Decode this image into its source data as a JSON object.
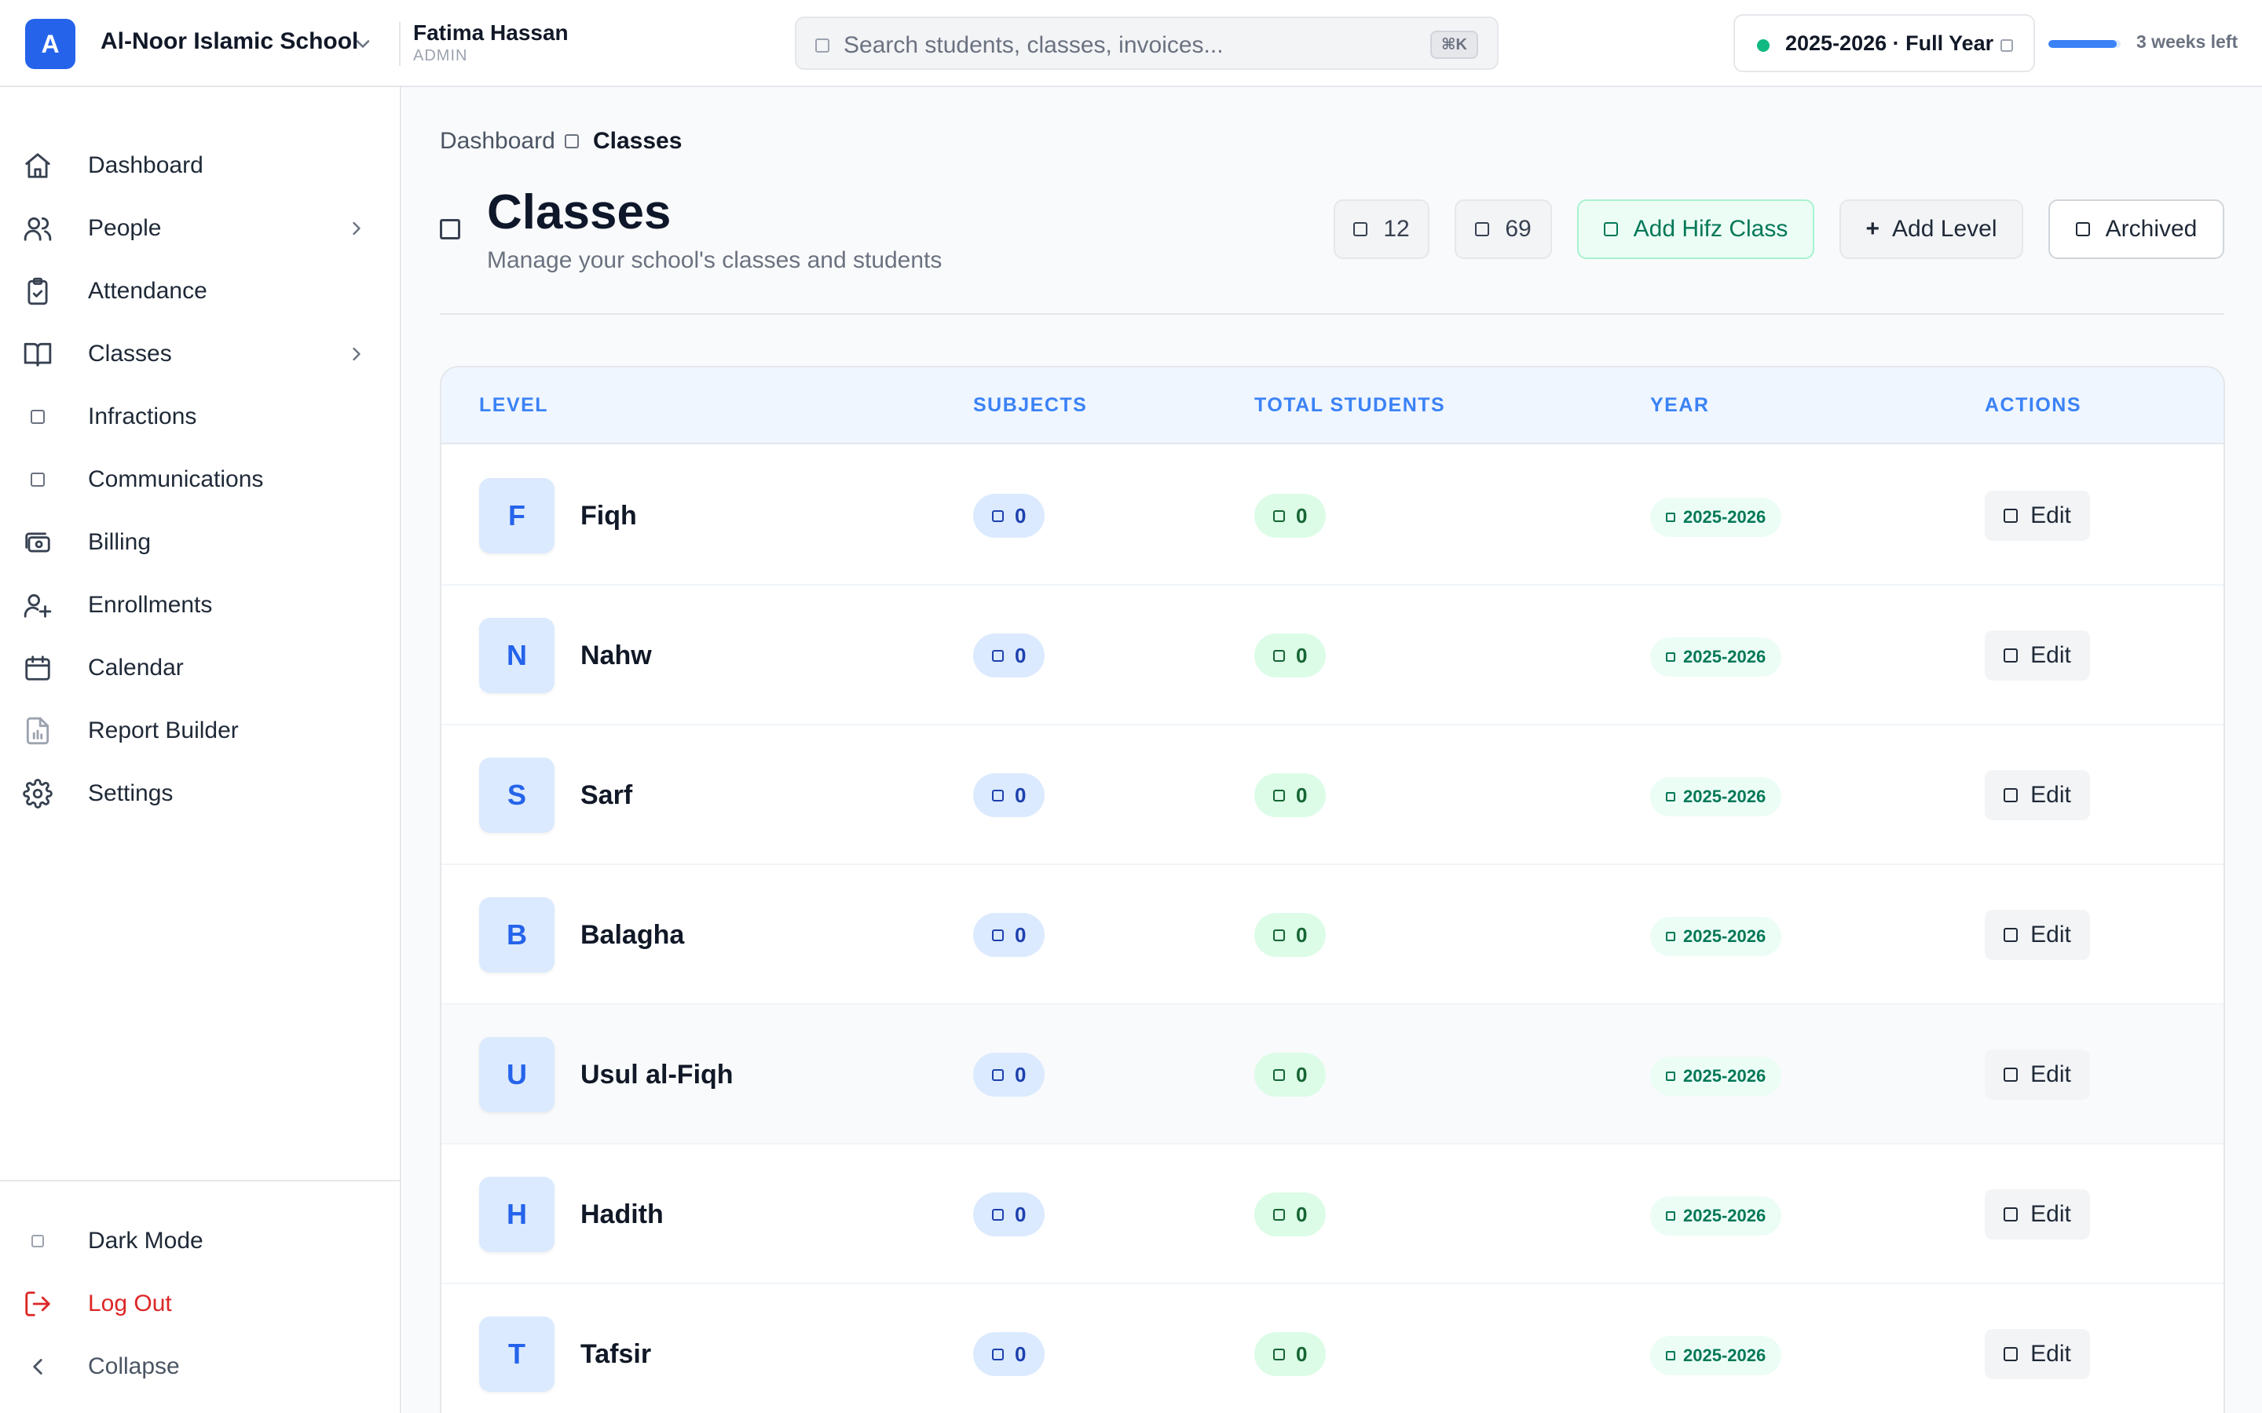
{
  "header": {
    "logo_letter": "A",
    "school_name": "Al-Noor Islamic School",
    "user_name": "Fatima Hassan",
    "user_role": "ADMIN",
    "search_placeholder": "Search students, classes, invoices...",
    "search_shortcut": "⌘K",
    "academic_year": "2025-2026 · Full Year",
    "term_progress_fraction": 0.95,
    "weeks_left": "3 weeks left"
  },
  "sidebar": {
    "items": [
      {
        "label": "Dashboard",
        "icon": "home-icon"
      },
      {
        "label": "People",
        "icon": "users-icon",
        "has_chevron": true
      },
      {
        "label": "Attendance",
        "icon": "clipboard-check-icon"
      },
      {
        "label": "Classes",
        "icon": "book-open-icon",
        "has_chevron": true
      },
      {
        "label": "Infractions",
        "icon": "placeholder-square-icon"
      },
      {
        "label": "Communications",
        "icon": "placeholder-square-icon"
      },
      {
        "label": "Billing",
        "icon": "banknote-icon"
      },
      {
        "label": "Enrollments",
        "icon": "user-plus-icon"
      },
      {
        "label": "Calendar",
        "icon": "calendar-icon"
      },
      {
        "label": "Report Builder",
        "icon": "file-chart-icon"
      },
      {
        "label": "Settings",
        "icon": "gear-icon"
      }
    ],
    "bottom": {
      "dark_mode": "Dark Mode",
      "log_out": "Log Out",
      "collapse": "Collapse"
    }
  },
  "main": {
    "breadcrumb": {
      "root": "Dashboard",
      "current": "Classes"
    },
    "title": "Classes",
    "subtitle": "Manage your school's classes and students",
    "stats": {
      "classes_count": "12",
      "students_count": "69"
    },
    "buttons": {
      "add_hifz": "Add Hifz Class",
      "add_level": "Add Level",
      "add_level_prefix": "+",
      "archived": "Archived"
    },
    "table": {
      "headers": {
        "level": "LEVEL",
        "subjects": "SUBJECTS",
        "total_students": "TOTAL STUDENTS",
        "year": "YEAR",
        "actions": "ACTIONS"
      },
      "rows": [
        {
          "initial": "F",
          "name": "Fiqh",
          "subjects": "0",
          "students": "0",
          "year": "2025-2026",
          "action": "Edit"
        },
        {
          "initial": "N",
          "name": "Nahw",
          "subjects": "0",
          "students": "0",
          "year": "2025-2026",
          "action": "Edit"
        },
        {
          "initial": "S",
          "name": "Sarf",
          "subjects": "0",
          "students": "0",
          "year": "2025-2026",
          "action": "Edit"
        },
        {
          "initial": "B",
          "name": "Balagha",
          "subjects": "0",
          "students": "0",
          "year": "2025-2026",
          "action": "Edit"
        },
        {
          "initial": "U",
          "name": "Usul al-Fiqh",
          "subjects": "0",
          "students": "0",
          "year": "2025-2026",
          "action": "Edit"
        },
        {
          "initial": "H",
          "name": "Hadith",
          "subjects": "0",
          "students": "0",
          "year": "2025-2026",
          "action": "Edit"
        },
        {
          "initial": "T",
          "name": "Tafsir",
          "subjects": "0",
          "students": "0",
          "year": "2025-2026",
          "action": "Edit"
        }
      ]
    }
  },
  "colors": {
    "accent": "#2563eb",
    "success": "#10b981",
    "danger": "#dc2626",
    "header_text_blue": "#3b82f6"
  }
}
